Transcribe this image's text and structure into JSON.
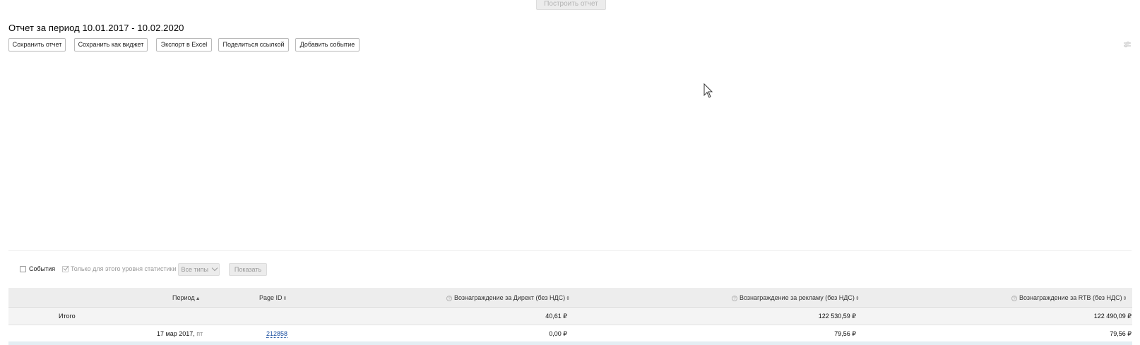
{
  "build_report_label": "Построить отчет",
  "report_title": "Отчет за период 10.01.2017 - 10.02.2020",
  "toolbar": {
    "save_report": "Сохранить отчет",
    "save_as_widget": "Сохранить как виджет",
    "export_excel": "Экспорт в Excel",
    "share_link": "Поделиться ссылкой",
    "add_event": "Добавить событие"
  },
  "events": {
    "events_label": "События",
    "only_level_label": "Только для этого уровня статистики",
    "types_select": "Все типы",
    "show_button": "Показать"
  },
  "table": {
    "columns": {
      "period": "Период",
      "page_id": "Page ID",
      "direct_reward": "Вознаграждение за Директ (без НДС)",
      "ad_reward": "Вознаграждение за рекламу (без НДС)",
      "rtb_reward": "Вознаграждение за RTB (без НДС)"
    },
    "total": {
      "label": "Итого",
      "direct": "40,61 ₽",
      "ad": "122 530,59 ₽",
      "rtb": "122 490,09 ₽"
    },
    "rows": [
      {
        "date": "17 мар 2017,",
        "weekday": "пт",
        "page_id": "212858",
        "direct": "0,00 ₽",
        "ad": "79,56 ₽",
        "rtb": "79,56 ₽"
      }
    ]
  },
  "colors": {
    "link": "#1a4fa0",
    "header_bg": "#ededed",
    "total_bg": "#f4f4f4"
  }
}
